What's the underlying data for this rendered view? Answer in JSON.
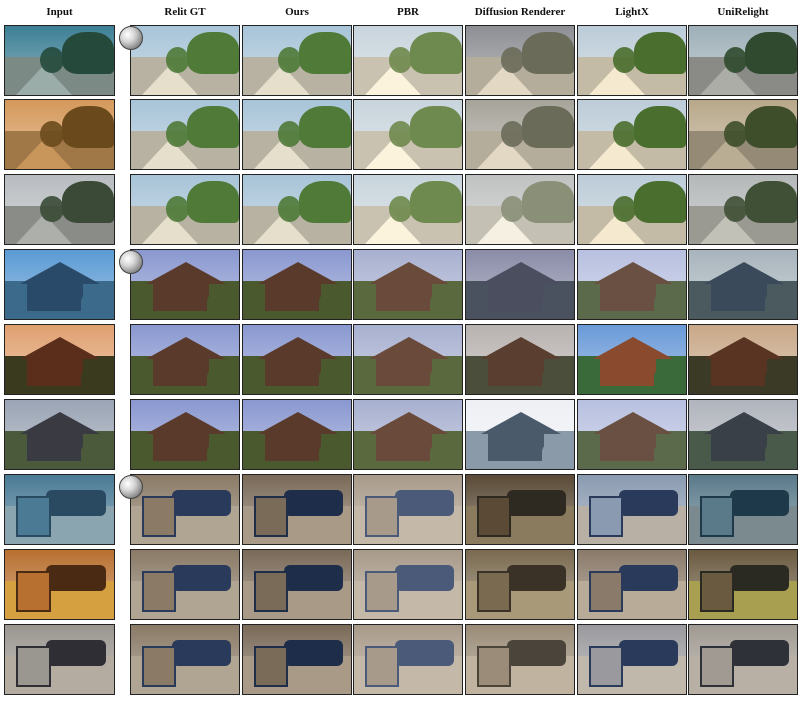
{
  "columns": [
    "Input",
    "Relit GT",
    "Ours",
    "PBR",
    "Diffusion Renderer",
    "LightX",
    "UniRelight"
  ],
  "palette": {
    "scenes": [
      {
        "name": "garden",
        "tints": [
          [
            "#3d7f95",
            "#254a3c",
            "#7c8a86"
          ],
          [
            "#a8c4d8",
            "#4f7a38",
            "#b7b2a2"
          ],
          [
            "#a8c4d8",
            "#4f7a38",
            "#b7b2a2"
          ],
          [
            "#c8d4dc",
            "#6f8a4e",
            "#c9c2b0"
          ],
          [
            "#8e8f94",
            "#6b6b5a",
            "#b5ad9c"
          ],
          [
            "#bcccd8",
            "#4a6e2e",
            "#c4bba6"
          ],
          [
            "#9fb0b8",
            "#2f4a2e",
            "#8a8a86"
          ]
        ]
      },
      {
        "name": "garden",
        "tints": [
          [
            "#d4985a",
            "#6a4a1c",
            "#a07848"
          ],
          [
            "#a8c4d8",
            "#4f7a38",
            "#b7b2a2"
          ],
          [
            "#a8c4d8",
            "#4f7a38",
            "#b7b2a2"
          ],
          [
            "#c8d4dc",
            "#6f8a4e",
            "#c9c2b0"
          ],
          [
            "#a6a49a",
            "#6b6b5a",
            "#b5ad9c"
          ],
          [
            "#bcccd8",
            "#4a6e2e",
            "#c4bba6"
          ],
          [
            "#b8a88a",
            "#3e4e2a",
            "#948a76"
          ]
        ]
      },
      {
        "name": "garden",
        "tints": [
          [
            "#b8bcc0",
            "#3a4a36",
            "#8a8c88"
          ],
          [
            "#a8c4d8",
            "#4f7a38",
            "#b7b2a2"
          ],
          [
            "#a8c4d8",
            "#4f7a38",
            "#b7b2a2"
          ],
          [
            "#c8d4dc",
            "#6f8a4e",
            "#c9c2b0"
          ],
          [
            "#c0c2c2",
            "#8a9078",
            "#c4c0b4"
          ],
          [
            "#bcccd8",
            "#4a6e2e",
            "#c4bba6"
          ],
          [
            "#b4b8b8",
            "#405036",
            "#9a9a92"
          ]
        ]
      },
      {
        "name": "pavilion",
        "tints": [
          [
            "#5a9ad4",
            "#2a4a6a",
            "#3c6a8a"
          ],
          [
            "#8a98d0",
            "#5a3a2a",
            "#4a5a2e"
          ],
          [
            "#8a98d0",
            "#5a3a2a",
            "#4a5a2e"
          ],
          [
            "#a8b0d0",
            "#6a4a3a",
            "#5a6a3e"
          ],
          [
            "#8a8ca8",
            "#4a4e5e",
            "#4a5260"
          ],
          [
            "#b8c0e0",
            "#6a5042",
            "#5a6a4a"
          ],
          [
            "#a8b4bc",
            "#3a4a5a",
            "#4a5a5e"
          ]
        ]
      },
      {
        "name": "pavilion",
        "tints": [
          [
            "#e0a070",
            "#5a2e1a",
            "#3a3a1e"
          ],
          [
            "#8a98d0",
            "#5a3a2a",
            "#4a5a2e"
          ],
          [
            "#8a98d0",
            "#5a3a2a",
            "#4a5a2e"
          ],
          [
            "#a8b0d0",
            "#6a4a3a",
            "#5a6a3e"
          ],
          [
            "#b8b2b0",
            "#5a3e30",
            "#4a4e3a"
          ],
          [
            "#6a9ad8",
            "#8a4a2e",
            "#3a6a3a"
          ],
          [
            "#c8a888",
            "#5a3422",
            "#3a3a26"
          ]
        ]
      },
      {
        "name": "pavilion",
        "tints": [
          [
            "#9aa4b4",
            "#3a3a42",
            "#4a5a3a"
          ],
          [
            "#8a98d0",
            "#5a3a2a",
            "#4a5a2e"
          ],
          [
            "#8a98d0",
            "#5a3a2a",
            "#4a5a2e"
          ],
          [
            "#a8b0d0",
            "#6a4a3a",
            "#5a6a3e"
          ],
          [
            "#eef0f4",
            "#4a5a6a",
            "#8a9aa8"
          ],
          [
            "#b8c0e0",
            "#6a5042",
            "#5a6a4a"
          ],
          [
            "#b0b4bc",
            "#3a4048",
            "#4a5a4a"
          ]
        ]
      },
      {
        "name": "room",
        "tints": [
          [
            "#4a7a94",
            "#2a4a62",
            "#8aa4b0"
          ],
          [
            "#8a7a66",
            "#2a3a5a",
            "#b0a492"
          ],
          [
            "#7a6a58",
            "#1e2e4a",
            "#a89a86"
          ],
          [
            "#a89a8a",
            "#4a5a78",
            "#c4b8a8"
          ],
          [
            "#5a4a36",
            "#2e2a22",
            "#8a7a5e"
          ],
          [
            "#8a9ab0",
            "#2a3a5a",
            "#b8b0a4"
          ],
          [
            "#5a7a8a",
            "#1e3a4a",
            "#7a8a8e"
          ]
        ]
      },
      {
        "name": "room",
        "tints": [
          [
            "#b87030",
            "#4a2a12",
            "#d4a040"
          ],
          [
            "#8a7a66",
            "#2a3a5a",
            "#b0a492"
          ],
          [
            "#7a6a58",
            "#1e2e4a",
            "#a89a86"
          ],
          [
            "#a89a8a",
            "#4a5a78",
            "#c4b8a8"
          ],
          [
            "#7a6a50",
            "#3a3226",
            "#a89a78"
          ],
          [
            "#8a7a6a",
            "#2a3a5a",
            "#b8ac98"
          ],
          [
            "#6a5a40",
            "#2a2a22",
            "#a8a050"
          ]
        ]
      },
      {
        "name": "room",
        "tints": [
          [
            "#9a9690",
            "#2e2e34",
            "#b4aca0"
          ],
          [
            "#8a7a66",
            "#2a3a5a",
            "#b0a492"
          ],
          [
            "#7a6a58",
            "#1e2e4a",
            "#a89a86"
          ],
          [
            "#a89a8a",
            "#4a5a78",
            "#c4b8a8"
          ],
          [
            "#9a8c78",
            "#4a443a",
            "#c0b4a0"
          ],
          [
            "#9a9a9e",
            "#2a3a5a",
            "#c0b8aa"
          ],
          [
            "#a09a92",
            "#2e3238",
            "#b8b0a4"
          ]
        ]
      }
    ]
  }
}
